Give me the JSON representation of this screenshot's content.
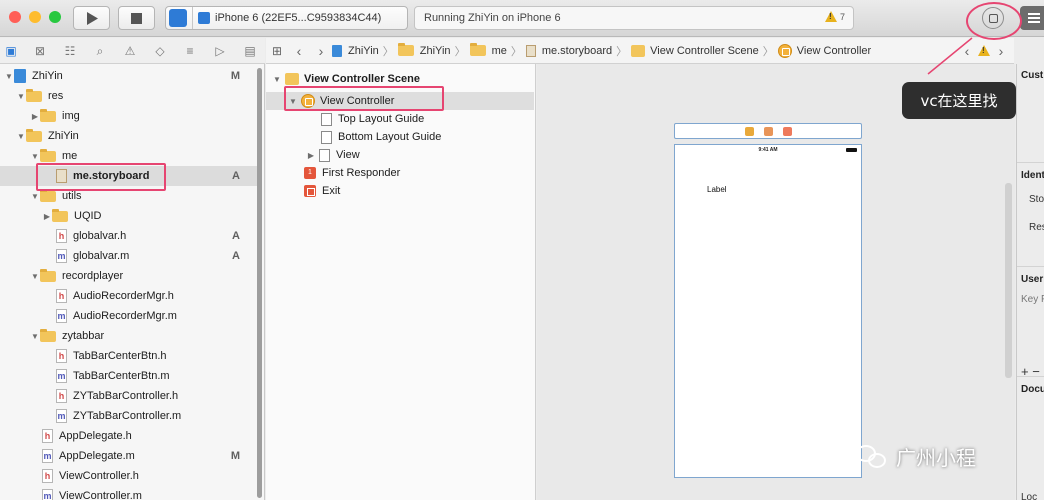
{
  "toolbar": {
    "scheme_label": "iPhone 6 (22EF5...C9593834C44)",
    "activity_text": "Running ZhiYin on iPhone 6",
    "warning_count": "7"
  },
  "navigator": {
    "rows": [
      {
        "label": "ZhiYin",
        "badge": "M"
      },
      {
        "label": "res",
        "badge": ""
      },
      {
        "label": "img",
        "badge": ""
      },
      {
        "label": "ZhiYin",
        "badge": ""
      },
      {
        "label": "me",
        "badge": ""
      },
      {
        "label": "me.storyboard",
        "badge": "A"
      },
      {
        "label": "utils",
        "badge": ""
      },
      {
        "label": "UQID",
        "badge": ""
      },
      {
        "label": "globalvar.h",
        "badge": "A"
      },
      {
        "label": "globalvar.m",
        "badge": "A"
      },
      {
        "label": "recordplayer",
        "badge": ""
      },
      {
        "label": "AudioRecorderMgr.h",
        "badge": ""
      },
      {
        "label": "AudioRecorderMgr.m",
        "badge": ""
      },
      {
        "label": "zytabbar",
        "badge": ""
      },
      {
        "label": "TabBarCenterBtn.h",
        "badge": ""
      },
      {
        "label": "TabBarCenterBtn.m",
        "badge": ""
      },
      {
        "label": "ZYTabBarController.h",
        "badge": ""
      },
      {
        "label": "ZYTabBarController.m",
        "badge": ""
      },
      {
        "label": "AppDelegate.h",
        "badge": ""
      },
      {
        "label": "AppDelegate.m",
        "badge": "M"
      },
      {
        "label": "ViewController.h",
        "badge": ""
      },
      {
        "label": "ViewController.m",
        "badge": ""
      }
    ]
  },
  "jumpbar": {
    "crumbs": [
      "ZhiYin",
      "ZhiYin",
      "me",
      "me.storyboard",
      "View Controller Scene",
      "View Controller"
    ]
  },
  "outline": {
    "scene_title": "View Controller Scene",
    "items": [
      "View Controller",
      "Top Layout Guide",
      "Bottom Layout Guide",
      "View",
      "First Responder",
      "Exit"
    ]
  },
  "canvas": {
    "status_time": "9:41 AM",
    "label_text": "Label"
  },
  "inspector": {
    "labels": [
      "Cust",
      "Ident",
      "Sto",
      "Res",
      "User",
      "Key P",
      "+ −",
      "Docu",
      "Loc"
    ]
  },
  "annotations": {
    "tooltip_text": "vc在这里找",
    "watermark_text": "广州小程",
    "accent_color": "#e64571"
  }
}
